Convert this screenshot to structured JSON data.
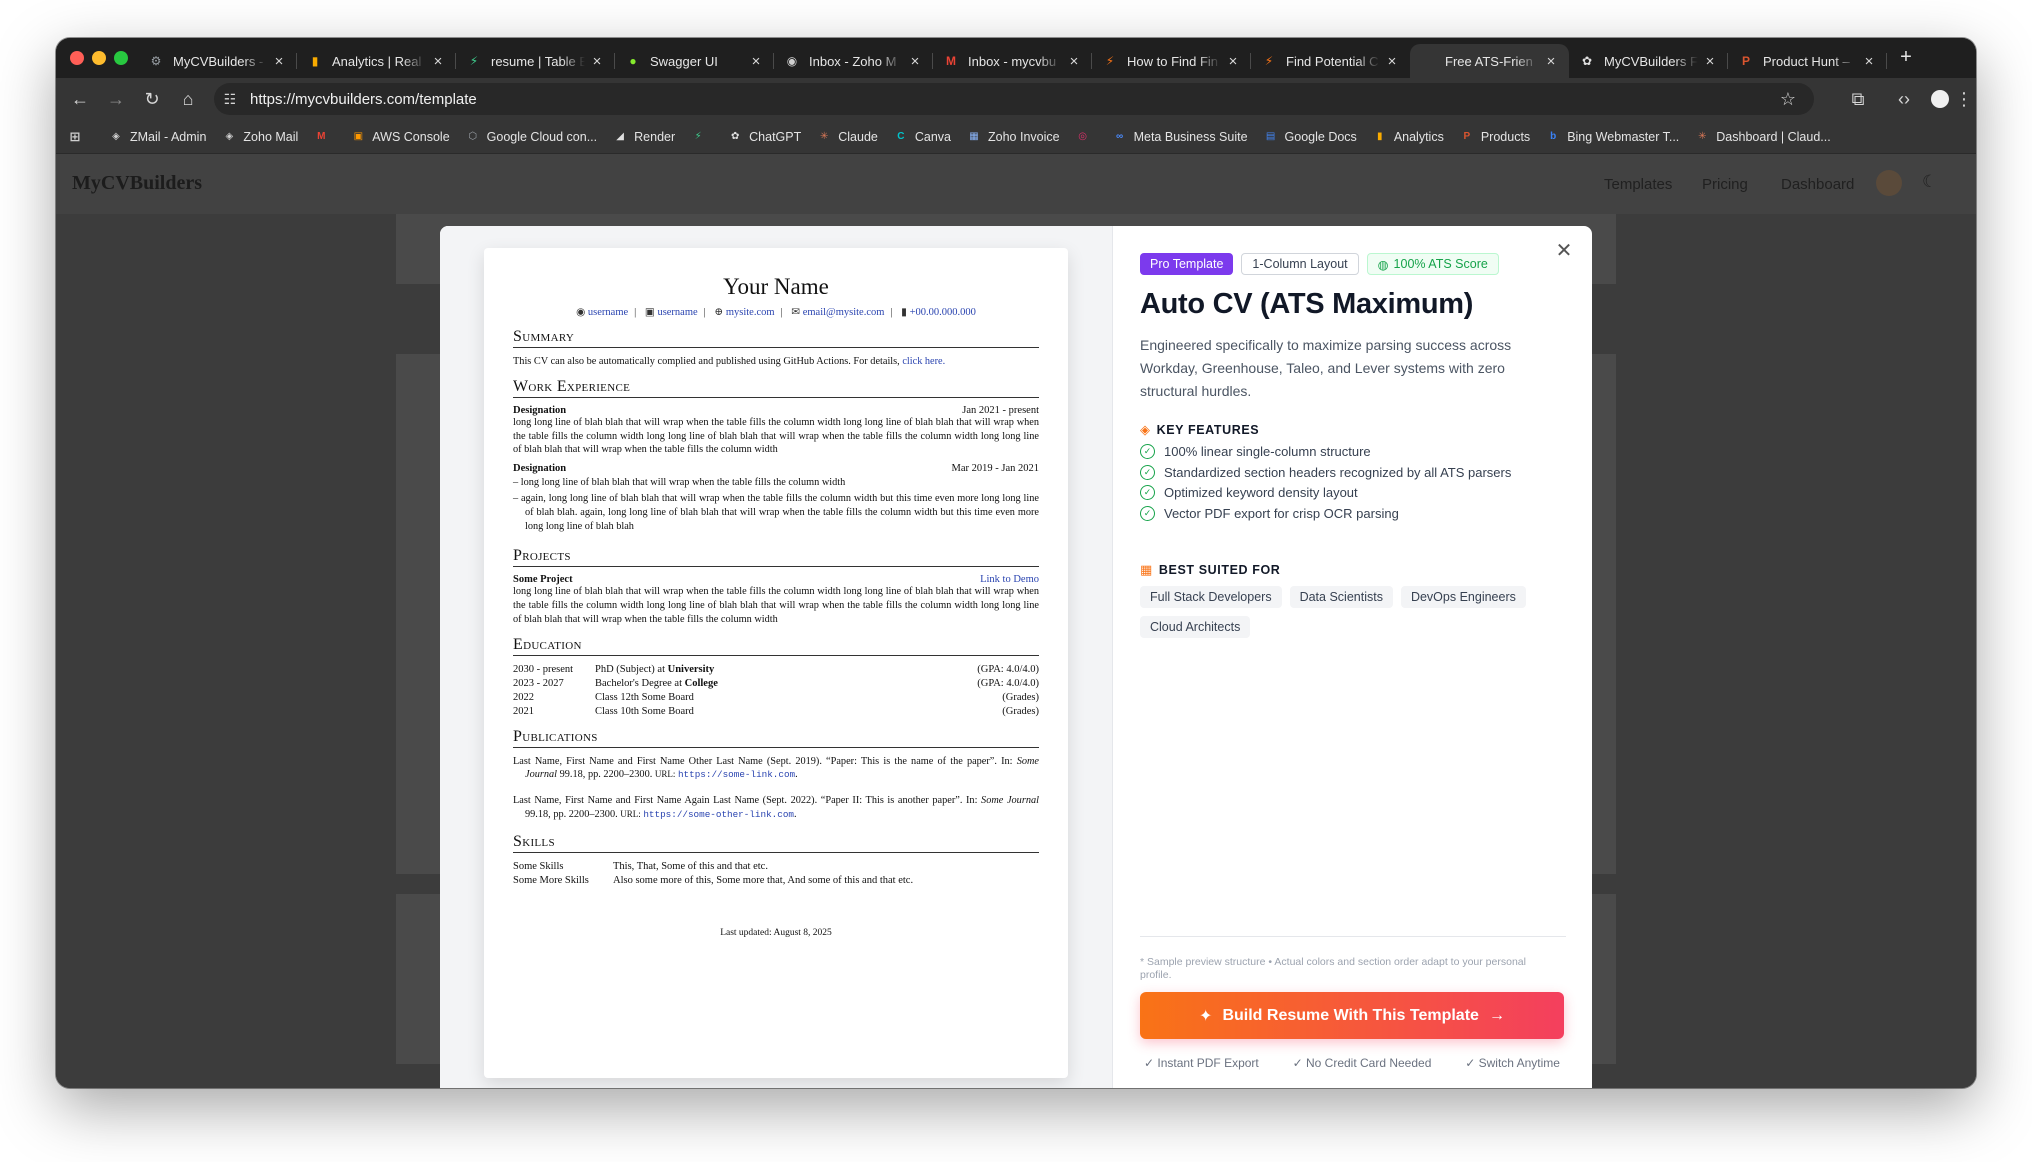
{
  "browser": {
    "tabs": [
      {
        "title": "MyCVBuilders -",
        "icon": "gear-icon",
        "color": "#9aa0a6",
        "glyph": "⚙"
      },
      {
        "title": "Analytics | Real",
        "icon": "analytics-icon",
        "color": "#f9ab00",
        "glyph": "▮"
      },
      {
        "title": "resume | Table E",
        "icon": "bolt-icon",
        "color": "#3ecf8e",
        "glyph": "⚡"
      },
      {
        "title": "Swagger UI",
        "icon": "swagger-icon",
        "color": "#85ea2d",
        "glyph": "●"
      },
      {
        "title": "Inbox - Zoho M",
        "icon": "mail-icon",
        "color": "#d0d0d0",
        "glyph": "◉"
      },
      {
        "title": "Inbox - mycvbu",
        "icon": "gmail-icon",
        "color": "#ea4335",
        "glyph": "M"
      },
      {
        "title": "How to Find Fin",
        "icon": "bolt-icon",
        "color": "#f97316",
        "glyph": "⚡"
      },
      {
        "title": "Find Potential C",
        "icon": "bolt-icon",
        "color": "#f97316",
        "glyph": "⚡"
      },
      {
        "title": "Free ATS-Frien",
        "icon": "page-icon",
        "color": "#555555",
        "glyph": ""
      },
      {
        "title": "MyCVBuilders F",
        "icon": "chatgpt-icon",
        "color": "#e0e0e0",
        "glyph": "✿"
      },
      {
        "title": "Product Hunt –",
        "icon": "producthunt-icon",
        "color": "#da552f",
        "glyph": "P"
      }
    ],
    "active_tab": 8,
    "url": "https://mycvbuilders.com/template",
    "bookmarks": [
      {
        "label": "ZMail - Admin",
        "icon": "zmail-icon",
        "color": "#d0d0d0",
        "glyph": "◈"
      },
      {
        "label": "Zoho Mail",
        "icon": "zoho-mail-icon",
        "color": "#d0d0d0",
        "glyph": "◈"
      },
      {
        "label": "",
        "icon": "gmail-icon",
        "color": "#ea4335",
        "glyph": "M"
      },
      {
        "label": "AWS Console",
        "icon": "aws-icon",
        "color": "#ff9900",
        "glyph": "▣"
      },
      {
        "label": "Google Cloud con...",
        "icon": "google-cloud-icon",
        "color": "#9aa0a6",
        "glyph": "⬡"
      },
      {
        "label": "Render",
        "icon": "render-icon",
        "color": "#e0e0e0",
        "glyph": "◢"
      },
      {
        "label": "",
        "icon": "bolt-icon",
        "color": "#3ecf8e",
        "glyph": "⚡"
      },
      {
        "label": "ChatGPT",
        "icon": "chatgpt-icon",
        "color": "#e0e0e0",
        "glyph": "✿"
      },
      {
        "label": "Claude",
        "icon": "claude-icon",
        "color": "#d97757",
        "glyph": "✳"
      },
      {
        "label": "Canva",
        "icon": "canva-icon",
        "color": "#00c4cc",
        "glyph": "C"
      },
      {
        "label": "Zoho Invoice",
        "icon": "zoho-invoice-icon",
        "color": "#8ab4f8",
        "glyph": "▦"
      },
      {
        "label": "",
        "icon": "instagram-icon",
        "color": "#e1306c",
        "glyph": "◎"
      },
      {
        "label": "Meta Business Suite",
        "icon": "meta-icon",
        "color": "#4a8cff",
        "glyph": "∞"
      },
      {
        "label": "Google Docs",
        "icon": "google-docs-icon",
        "color": "#4285f4",
        "glyph": "▤"
      },
      {
        "label": "Analytics",
        "icon": "analytics-icon",
        "color": "#f9ab00",
        "glyph": "▮"
      },
      {
        "label": "Products",
        "icon": "producthunt-icon",
        "color": "#da552f",
        "glyph": "P"
      },
      {
        "label": "Bing Webmaster T...",
        "icon": "bing-icon",
        "color": "#3b82f6",
        "glyph": "b"
      },
      {
        "label": "Dashboard | Claud...",
        "icon": "claude-icon",
        "color": "#d97757",
        "glyph": "✳"
      }
    ]
  },
  "site": {
    "logo": "MyCVBuilders",
    "nav": [
      "Templates",
      "Pricing",
      "Dashboard"
    ]
  },
  "modal": {
    "badges": {
      "pro": "Pro Template",
      "layout": "1-Column Layout",
      "ats": "100% ATS Score"
    },
    "title": "Auto CV (ATS Maximum)",
    "description": "Engineered specifically to maximize parsing success across Workday, Greenhouse, Taleo, and Lever systems with zero structural hurdles.",
    "key_features_heading": "KEY FEATURES",
    "features": [
      "100% linear single-column structure",
      "Standardized section headers recognized by all ATS parsers",
      "Optimized keyword density layout",
      "Vector PDF export for crisp OCR parsing"
    ],
    "best_suited_heading": "BEST SUITED FOR",
    "roles": [
      "Full Stack Developers",
      "Data Scientists",
      "DevOps Engineers",
      "Cloud Architects"
    ],
    "note": "* Sample preview structure • Actual colors and section order adapt to your personal profile.",
    "cta": "Build Resume With This Template",
    "perks": [
      "✓ Instant PDF Export",
      "✓ No Credit Card Needed",
      "✓ Switch Anytime"
    ],
    "colors": {
      "pro_badge": "#7c3aed",
      "ats_green": "#16a34a",
      "cta_start": "#f97316",
      "cta_end": "#f43f5e"
    }
  },
  "cv": {
    "name": "Your Name",
    "contacts": [
      "username",
      "username",
      "mysite.com",
      "email@mysite.com",
      "+00.00.000.000"
    ],
    "summary_h": "Summary",
    "summary": "This CV can also be automatically complied and published using GitHub Actions. For details,",
    "summary_link": "click here.",
    "work_h": "Work Experience",
    "job1_title": "Designation",
    "job1_date": "Jan 2021 - present",
    "job1_text": "long long line of blah blah that will wrap when the table fills the column width long long line of blah blah that will wrap when the table fills the column width long long line of blah blah that will wrap when the table fills the column width long long line of blah blah that will wrap when the table fills the column width",
    "job2_title": "Designation",
    "job2_date": "Mar 2019 - Jan 2021",
    "job2_b1": "– long long line of blah blah that will wrap when the table fills the column width",
    "job2_b2": "– again, long long line of blah blah that will wrap when the table fills the column width but this time even more long long line of blah blah. again, long long line of blah blah that will wrap when the table fills the column width but this time even more long long line of blah blah",
    "projects_h": "Projects",
    "proj_title": "Some Project",
    "proj_link": "Link to Demo",
    "proj_text": "long long line of blah blah that will wrap when the table fills the column width long long line of blah blah that will wrap when the table fills the column width long long line of blah blah that will wrap when the table fills the column width long long line of blah blah that will wrap when the table fills the column width",
    "edu_h": "Education",
    "edu": [
      {
        "years": "2030 - present",
        "degree": "PhD (Subject) at ",
        "inst": "University",
        "grade": "(GPA: 4.0/4.0)"
      },
      {
        "years": "2023 - 2027",
        "degree": "Bachelor's Degree at ",
        "inst": "College",
        "grade": "(GPA: 4.0/4.0)"
      },
      {
        "years": "2022",
        "degree": "Class 12th Some Board",
        "inst": "",
        "grade": "(Grades)"
      },
      {
        "years": "2021",
        "degree": "Class 10th Some Board",
        "inst": "",
        "grade": "(Grades)"
      }
    ],
    "pubs_h": "Publications",
    "pub1_a": "Last Name, First Name and First Name Other Last Name (Sept. 2019). “Paper: This is the name of the paper”. In: ",
    "pub1_j": "Some Journal",
    "pub1_b": " 99.18, pp. 2200–2300. ",
    "pub1_url_lbl": "URL:",
    "pub1_url": "https://some-link.com",
    "pub2_a": "Last Name, First Name and First Name Again Last Name (Sept. 2022). “Paper II: This is another paper”. In: ",
    "pub2_j": "Some Journal",
    "pub2_b": " 99.18, pp. 2200–2300. ",
    "pub2_url_lbl": "URL:",
    "pub2_url": "https://some-other-link.com",
    "skills_h": "Skills",
    "skills": [
      {
        "k": "Some Skills",
        "v": "This, That, Some of this and that etc."
      },
      {
        "k": "Some More Skills",
        "v": "Also some more of this, Some more that, And some of this and that etc."
      }
    ],
    "footer": "Last updated: August 8, 2025"
  }
}
